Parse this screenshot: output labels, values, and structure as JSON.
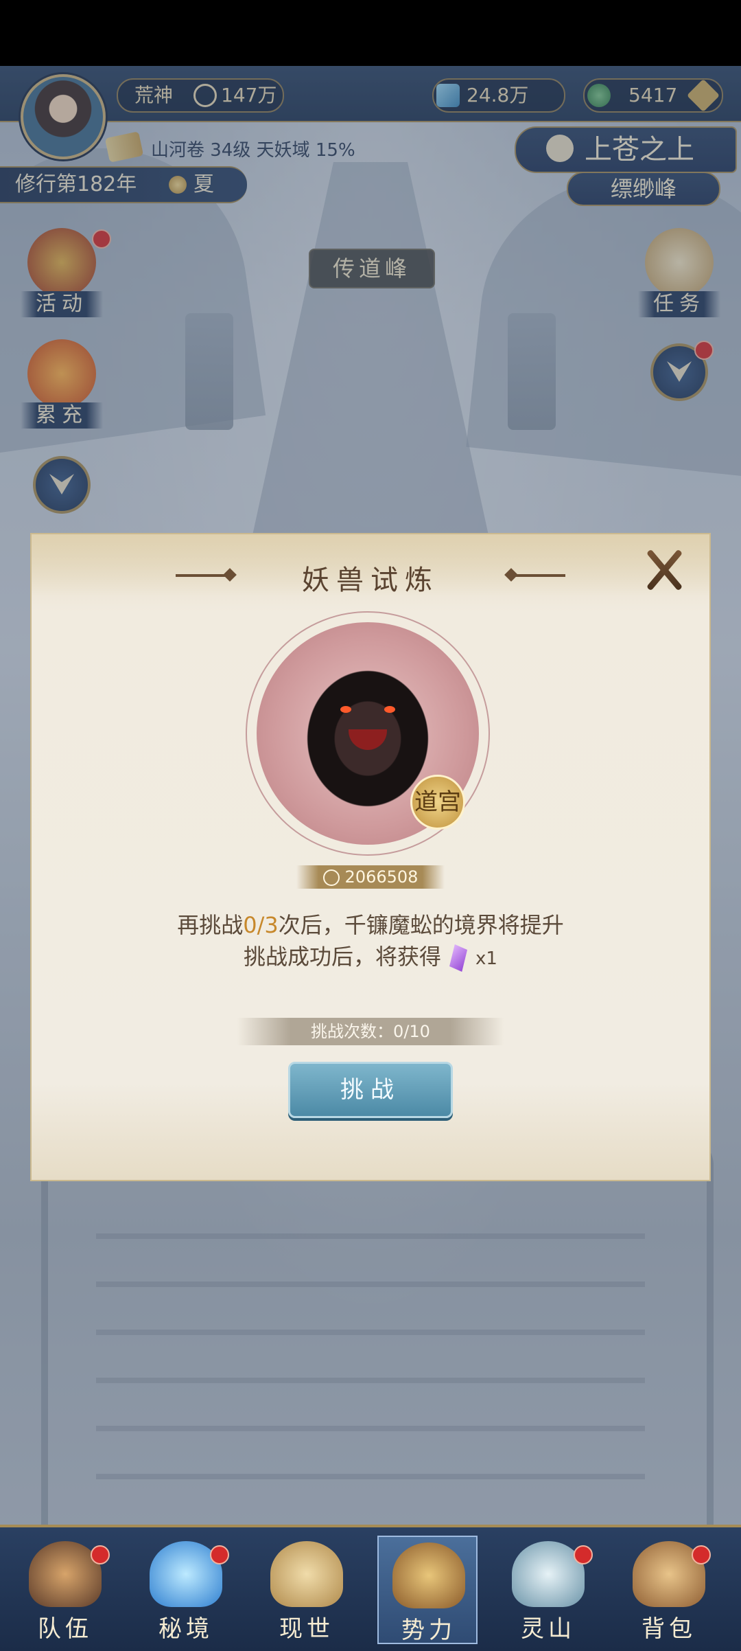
{
  "hud": {
    "player_title": "荒神",
    "power": "147万",
    "currency1": "24.8万",
    "currency2": "5417",
    "scroll_info": "山河卷 34级 天妖域 15%",
    "cultivation_year": "修行第182年",
    "season": "夏",
    "location": "上苍之上",
    "sub_location": "缥缈峰",
    "icons": {
      "power": "sword-icon",
      "currency1": "crystal-icon",
      "currency2": "jade-coin-icon",
      "add": "add-diamond-icon"
    }
  },
  "side_left": [
    {
      "label": "活动",
      "icon": "treasure-drum-icon",
      "badge": true
    },
    {
      "label": "累充",
      "icon": "fire-lantern-icon",
      "badge": false
    }
  ],
  "side_right": [
    {
      "label": "任务",
      "icon": "scroll-icon",
      "badge": false
    }
  ],
  "map_label": "传道峰",
  "dialog": {
    "title": "妖兽试炼",
    "rank_badge": "道宫",
    "power": "2066508",
    "line1_prefix": "再挑战",
    "line1_count": "0/3",
    "line1_suffix": "次后，千镰魔蚣的境界将提升",
    "line2_prefix": "挑战成功后，将获得",
    "reward_qty": "x1",
    "attempts": "挑战次数：0/10",
    "challenge_button": "挑战",
    "colors": {
      "highlight": "#c7882b",
      "button": "#5a97b3"
    }
  },
  "bottom_nav": [
    {
      "label": "队伍",
      "icon": "hat-icon",
      "badge": true,
      "active": false
    },
    {
      "label": "秘境",
      "icon": "vortex-icon",
      "badge": true,
      "active": false
    },
    {
      "label": "现世",
      "icon": "map-scroll-icon",
      "badge": false,
      "active": false
    },
    {
      "label": "势力",
      "icon": "temple-icon",
      "badge": false,
      "active": true
    },
    {
      "label": "灵山",
      "icon": "mountain-icon",
      "badge": true,
      "active": false
    },
    {
      "label": "背包",
      "icon": "bag-icon",
      "badge": true,
      "active": false
    }
  ]
}
